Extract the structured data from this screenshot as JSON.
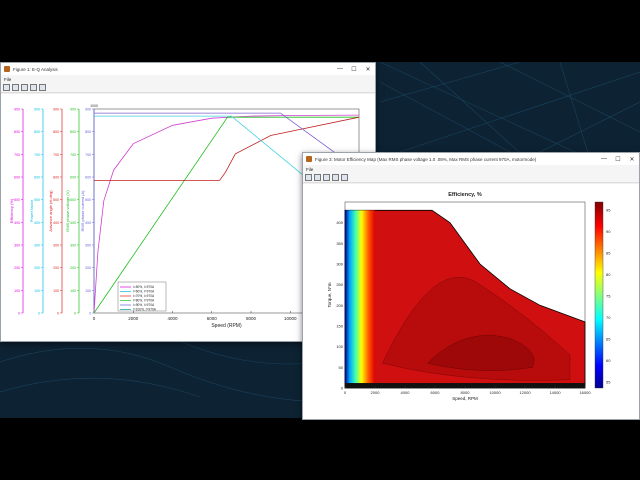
{
  "window1": {
    "title": "Figure 1: E-Q Analysis",
    "menu": "File"
  },
  "window2": {
    "title": "Figure 3: Motor Efficiency Map (Max RMS phase voltage 1.0 .08%, Max RMS phase current 970A, motormode)",
    "menu": "File"
  },
  "controls": {
    "minimize": "—",
    "maximize": "☐",
    "close": "✕"
  },
  "chart1": {
    "xlabel": "Speed (RPM)",
    "xticks": [
      "0",
      "2000",
      "4000",
      "6000",
      "8000",
      "10000",
      "12000"
    ],
    "axis_labels": [
      "Efficiency (%)",
      "Power factor",
      "Advance angle (el.deg)",
      "RMS phase voltage (V)",
      "RMS phase current (A)"
    ],
    "axis_colors": [
      "#e000e0",
      "#00c0e0",
      "#e02020",
      "#20c020",
      "#6060e0"
    ],
    "ytick_top": [
      "900",
      "800",
      "700",
      "600",
      "500",
      "400",
      "300",
      "200",
      "100",
      "0"
    ],
    "y_top_label": "1000",
    "legend": [
      "I=50%, I=970A",
      "I=60%, I=970A",
      "I=70%, I=970A",
      "I=80%, I=970A",
      "I=90%, I=970A",
      "I=100%, I=970A"
    ],
    "legend_colors": [
      "#e000e0",
      "#00c0e0",
      "#e02020",
      "#20c020",
      "#6060e0",
      "#00a0a0"
    ]
  },
  "chart2": {
    "title": "Efficiency, %",
    "xlabel": "Speed, RPM",
    "ylabel": "Torque, N*m",
    "xticks": [
      "0",
      "2000",
      "4000",
      "6000",
      "8000",
      "10000",
      "12000",
      "14000",
      "16000"
    ],
    "yticks": [
      "400",
      "350",
      "300",
      "250",
      "200",
      "150",
      "100",
      "50",
      "0"
    ],
    "cbar_ticks": [
      "95",
      "90",
      "85",
      "80",
      "75",
      "70",
      "65",
      "60",
      "55"
    ]
  },
  "chart_data": [
    {
      "type": "line",
      "xlabel": "Speed (RPM)",
      "xlim": [
        0,
        13500
      ],
      "ylim": [
        0,
        1000
      ],
      "series": [
        {
          "name": "Efficiency",
          "x": [
            0,
            200,
            500,
            1000,
            2000,
            4000,
            6000,
            8000,
            10000,
            13500
          ],
          "y": [
            0,
            300,
            550,
            700,
            830,
            920,
            955,
            965,
            968,
            970
          ]
        },
        {
          "name": "RMS phase voltage",
          "x": [
            0,
            6800,
            13500
          ],
          "y": [
            0,
            960,
            960
          ]
        },
        {
          "name": "RMS phase current",
          "x": [
            0,
            6400,
            6700,
            7200,
            9000,
            13500
          ],
          "y": [
            650,
            650,
            690,
            780,
            870,
            960
          ]
        },
        {
          "name": "Power factor",
          "x": [
            0,
            6000,
            7000,
            13500
          ],
          "y": [
            965,
            965,
            965,
            450
          ]
        },
        {
          "name": "Advance angle",
          "x": [
            0,
            9500,
            13500
          ],
          "y": [
            980,
            980,
            700
          ]
        }
      ]
    },
    {
      "type": "heatmap",
      "title": "Efficiency, %",
      "xlabel": "Speed, RPM",
      "ylabel": "Torque, N*m",
      "xlim": [
        0,
        16000
      ],
      "ylim": [
        0,
        450
      ],
      "clim": [
        55,
        98
      ]
    }
  ]
}
